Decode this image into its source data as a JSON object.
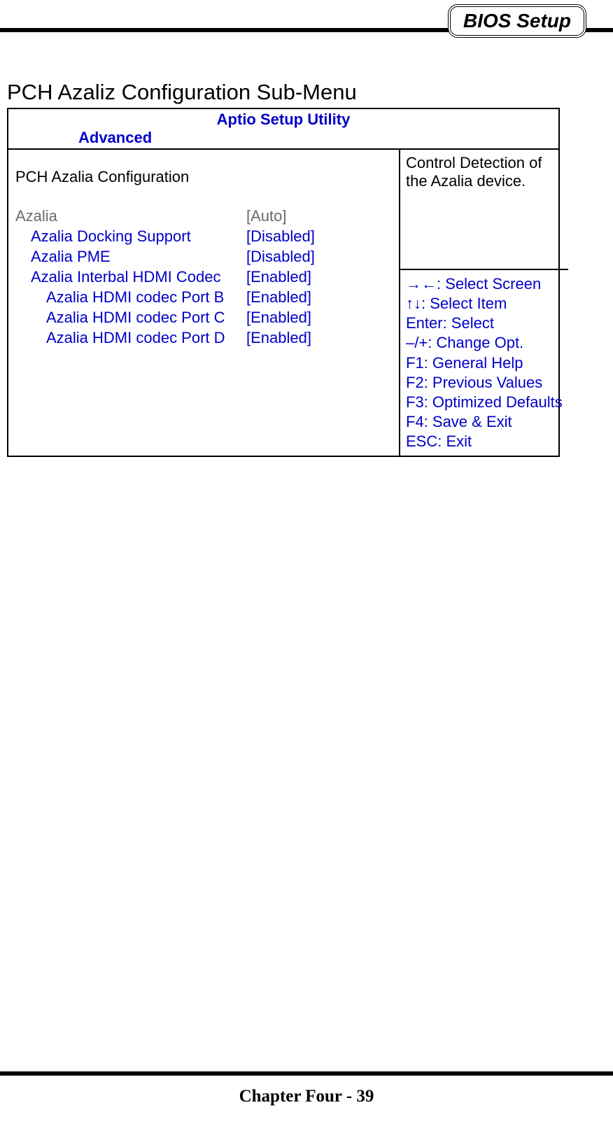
{
  "header": {
    "badge": "BIOS Setup"
  },
  "section_heading": "PCH Azaliz Configuration Sub-Menu",
  "bios": {
    "utility_title": "Aptio Setup Utility",
    "active_tab": "Advanced",
    "config_title": "PCH Azalia Configuration",
    "options": [
      {
        "label": "Azalia",
        "value": "[Auto]",
        "indent": 0,
        "tone": "gray"
      },
      {
        "label": "Azalia Docking Support",
        "value": "[Disabled]",
        "indent": 1,
        "tone": "blue"
      },
      {
        "label": "Azalia PME",
        "value": "[Disabled]",
        "indent": 1,
        "tone": "blue"
      },
      {
        "label": "Azalia Interbal HDMI Codec",
        "value": "[Enabled]",
        "indent": 1,
        "tone": "blue"
      },
      {
        "label": "Azalia HDMI codec Port B",
        "value": "[Enabled]",
        "indent": 2,
        "tone": "blue"
      },
      {
        "label": "Azalia HDMI codec Port C",
        "value": "[Enabled]",
        "indent": 2,
        "tone": "blue"
      },
      {
        "label": "Azalia HDMI codec Port D",
        "value": "[Enabled]",
        "indent": 2,
        "tone": "blue"
      }
    ],
    "help_description": "Control Detection of the Azalia device.",
    "key_help": [
      "→←: Select Screen",
      "↑↓: Select Item",
      "Enter: Select",
      "–/+: Change Opt.",
      "F1: General Help",
      "F2: Previous Values",
      "F3: Optimized Defaults",
      "F4: Save & Exit",
      "ESC: Exit"
    ]
  },
  "footer": "Chapter Four - 39"
}
